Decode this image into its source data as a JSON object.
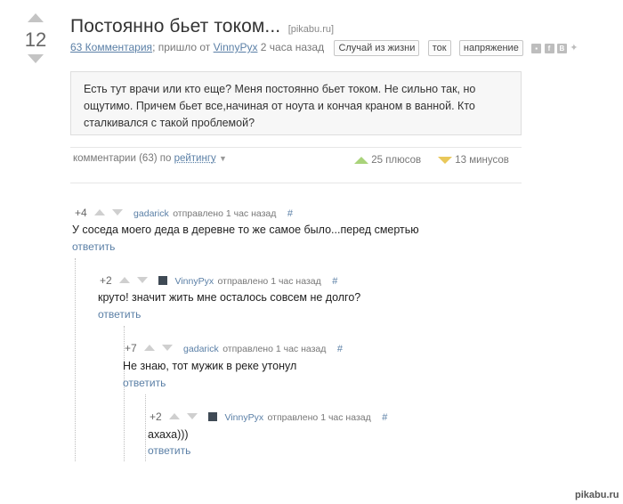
{
  "post": {
    "rating": "12",
    "title": "Постоянно бьет током...",
    "source": "[pikabu.ru]",
    "comments_link": "63 Комментария",
    "meta_text_1": "; пришло от",
    "author": "VinnyPyx",
    "time": "2 часа назад",
    "tags": [
      "Случай из жизни",
      "ток",
      "напряжение"
    ],
    "share_icons": [
      "save-icon",
      "facebook-icon",
      "vk-icon",
      "twitter-icon"
    ],
    "story": "Есть тут врачи или кто еще? Меня постоянно бьет током. Не сильно так, но ощутимо. Причем бьет все,начиная от ноута и кончая краном в ванной. Кто сталкивался с такой проблемой?"
  },
  "comments_header": {
    "count_text": "комментарии (63) по",
    "sort_label": "рейтингу",
    "pluses": "25 плюсов",
    "minuses": "13 минусов"
  },
  "comments": [
    {
      "rating": "+4",
      "author": "gadarick",
      "sent": "отправлено 1 час назад",
      "hash": "#",
      "text": "У соседа моего деда в деревне то же самое было...перед смертью",
      "reply": "ответить",
      "has_avatar": false
    },
    {
      "rating": "+2",
      "author": "VinnyPyx",
      "sent": "отправлено 1 час назад",
      "hash": "#",
      "text": "круто! значит жить мне осталось совсем не долго?",
      "reply": "ответить",
      "has_avatar": true
    },
    {
      "rating": "+7",
      "author": "gadarick",
      "sent": "отправлено 1 час назад",
      "hash": "#",
      "text": "Не знаю, тот мужик в реке утонул",
      "reply": "ответить",
      "has_avatar": false
    },
    {
      "rating": "+2",
      "author": "VinnyPyx",
      "sent": "отправлено 1 час назад",
      "hash": "#",
      "text": "ахаха)))",
      "reply": "ответить",
      "has_avatar": true
    }
  ],
  "watermark": "pikabu.ru",
  "colors": {
    "link": "#5a7fa6",
    "plus": "#a9d37a",
    "minus": "#e9c85a"
  }
}
